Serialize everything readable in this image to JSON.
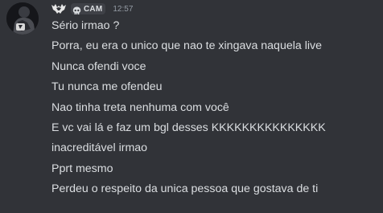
{
  "message": {
    "username_icon": "bat-emblem-icon",
    "clan_tag": "CAM",
    "clan_icon": "skull-icon",
    "timestamp": "12:57",
    "lines": [
      "Sério irmao ?",
      "Porra, eu era o unico que nao te xingava naquela live",
      "Nunca ofendi voce",
      "Tu nunca me ofendeu",
      "Nao tinha treta nenhuma com você",
      "E vc vai lá e faz um bgl desses KKKKKKKKKKKKKKK",
      "inacreditável irmao",
      "Pprt mesmo",
      "Perdeu o respeito da unica pessoa que gostava de ti"
    ]
  },
  "colors": {
    "background": "#313338",
    "text": "#dbdee1",
    "timestamp": "#949ba4",
    "tag_background": "#3f4147"
  }
}
